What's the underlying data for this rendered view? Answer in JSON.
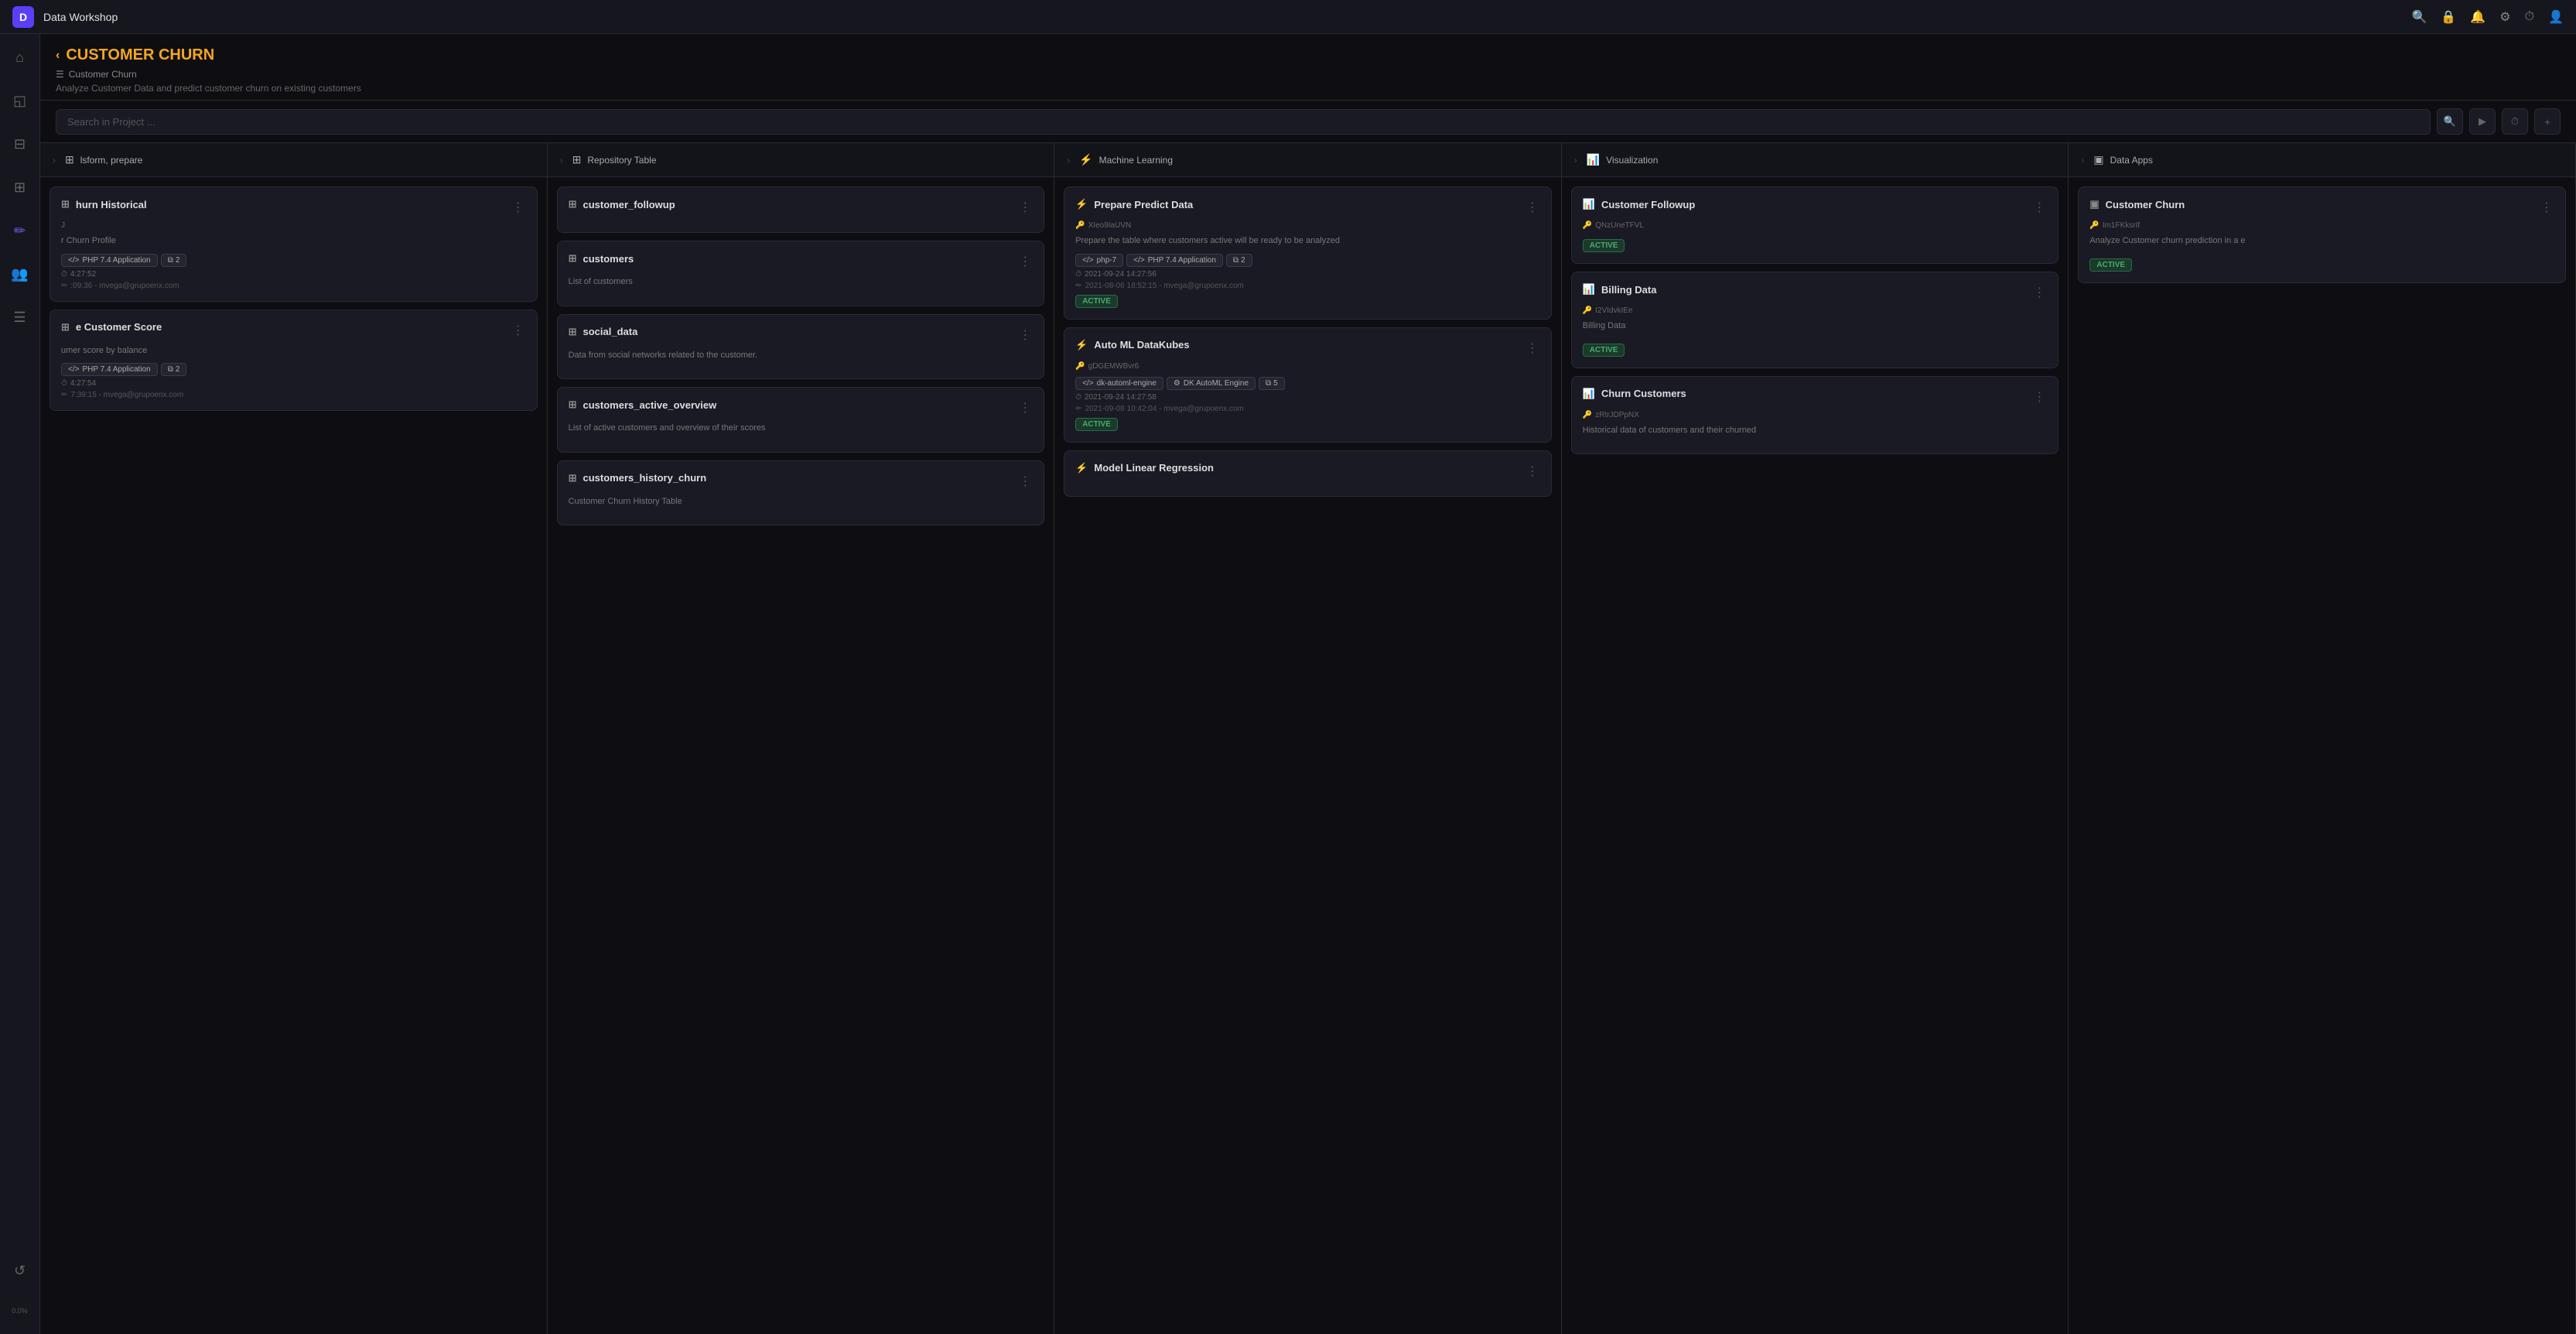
{
  "app": {
    "title": "Data Workshop",
    "logo": "D"
  },
  "topbar": {
    "icons": [
      "search",
      "lock",
      "bell",
      "settings",
      "activity",
      "user"
    ]
  },
  "sidebar": {
    "items": [
      {
        "id": "home",
        "icon": "⌂",
        "active": false
      },
      {
        "id": "chart",
        "icon": "◱",
        "active": false
      },
      {
        "id": "layers",
        "icon": "⊟",
        "active": false
      },
      {
        "id": "data",
        "icon": "⊞",
        "active": false
      },
      {
        "id": "brush",
        "icon": "✏",
        "active": true
      },
      {
        "id": "users",
        "icon": "👥",
        "active": false
      },
      {
        "id": "docs",
        "icon": "☰",
        "active": false
      }
    ],
    "bottom": [
      {
        "id": "refresh",
        "icon": "↺"
      },
      {
        "id": "percent",
        "icon": "0.0%"
      }
    ]
  },
  "project": {
    "title": "CUSTOMER CHURN",
    "chevron": "‹",
    "meta_icon": "☰",
    "meta_label": "Customer Churn",
    "description": "Analyze Customer Data and predict customer churn on existing customers"
  },
  "search": {
    "placeholder": "Search in Project ..."
  },
  "pipeline": {
    "columns": [
      {
        "id": "transform",
        "icon": "⊞",
        "label": "lsform, prepare",
        "cards": [
          {
            "id": "churn-historical",
            "title": "hurn Historical",
            "icon": "⊞",
            "sub": "J",
            "extra_label": "r Churn Profile",
            "tag_php": "PHP 7.4 Application",
            "tag_count": "2",
            "timestamp": "4:27:52",
            "user": ":09:36 - mvega@grupoenx.com",
            "has_menu": true
          },
          {
            "id": "customer-score",
            "title": "e Customer Score",
            "icon": "⊞",
            "sub": "",
            "extra_label": "umer score by balance",
            "tag_php": "PHP 7.4 Application",
            "tag_count": "2",
            "timestamp": "4:27:54",
            "user": "7:39:15 - mvega@grupoenx.com",
            "has_menu": true
          }
        ]
      },
      {
        "id": "repository",
        "icon": "⊞",
        "label": "Repository Table",
        "cards": [
          {
            "id": "customer-followup",
            "title": "customer_followup",
            "icon": "⊞",
            "description": "",
            "has_menu": true
          },
          {
            "id": "customers",
            "title": "customers",
            "icon": "⊞",
            "description": "List of customers",
            "has_menu": true
          },
          {
            "id": "social-data",
            "title": "social_data",
            "icon": "⊞",
            "description": "Data from social networks related to the customer.",
            "has_menu": true
          },
          {
            "id": "customers-active-overview",
            "title": "customers_active_overview",
            "icon": "⊞",
            "description": "List of active customers and overview of their scores",
            "has_menu": true
          },
          {
            "id": "customers-history-churn",
            "title": "customers_history_churn",
            "icon": "⊞",
            "description": "Customer Churn History Table",
            "has_menu": true
          }
        ]
      },
      {
        "id": "machine-learning",
        "icon": "⚡",
        "label": "Machine Learning",
        "cards": [
          {
            "id": "prepare-predict-data",
            "title": "Prepare Predict Data",
            "icon": "⚡",
            "key_id": "XIeo9IaUVN",
            "description": "Prepare the table where customers active will be ready to be analyzed",
            "tag_php7": "php-7",
            "tag_app": "PHP 7.4 Application",
            "tag_count": "2",
            "timestamp": "2021-09-24 14:27:56",
            "user_edit": "2021-08-06 18:52:15 - mvega@grupoenx.com",
            "status": "ACTIVE",
            "has_menu": true
          },
          {
            "id": "auto-ml-datakubes",
            "title": "Auto ML DataKubes",
            "icon": "⚡",
            "key_id": "gDGEMWBvr6",
            "tag_dk": "dk-automl-engine",
            "tag_dk2": "DK AutoML Engine",
            "tag_count": "5",
            "timestamp": "2021-09-24 14:27:58",
            "user_edit": "2021-09-08 10:42:04 - mvega@grupoenx.com",
            "status": "ACTIVE",
            "has_menu": true
          },
          {
            "id": "model-linear-regression",
            "title": "Model Linear Regression",
            "icon": "⚡",
            "has_menu": true
          }
        ]
      },
      {
        "id": "visualization",
        "icon": "📊",
        "label": "Visualization",
        "cards": [
          {
            "id": "customer-followup-viz",
            "title": "Customer Followup",
            "icon": "📊",
            "key_id": "QNzUneTFVL",
            "status": "ACTIVE",
            "has_menu": true
          },
          {
            "id": "billing-data",
            "title": "Billing Data",
            "icon": "📊",
            "key_id": "I2VIdvkIEe",
            "description": "Billing Data",
            "status": "ACTIVE",
            "has_menu": true
          },
          {
            "id": "churn-customers",
            "title": "Churn Customers",
            "icon": "📊",
            "key_id": "zRtrJDPpNX",
            "description": "Historical data of customers and their churned",
            "has_menu": true
          }
        ]
      },
      {
        "id": "data-apps",
        "icon": "▣",
        "label": "Data Apps",
        "cards": [
          {
            "id": "customer-churn-app",
            "title": "Customer Churn",
            "icon": "▣",
            "key_id": "Im1FKksrIf",
            "description": "Analyze Customer churn prediction in a e",
            "status": "ACTIVE",
            "has_menu": true
          }
        ]
      }
    ]
  },
  "footer": {
    "percent": "0.0%"
  }
}
